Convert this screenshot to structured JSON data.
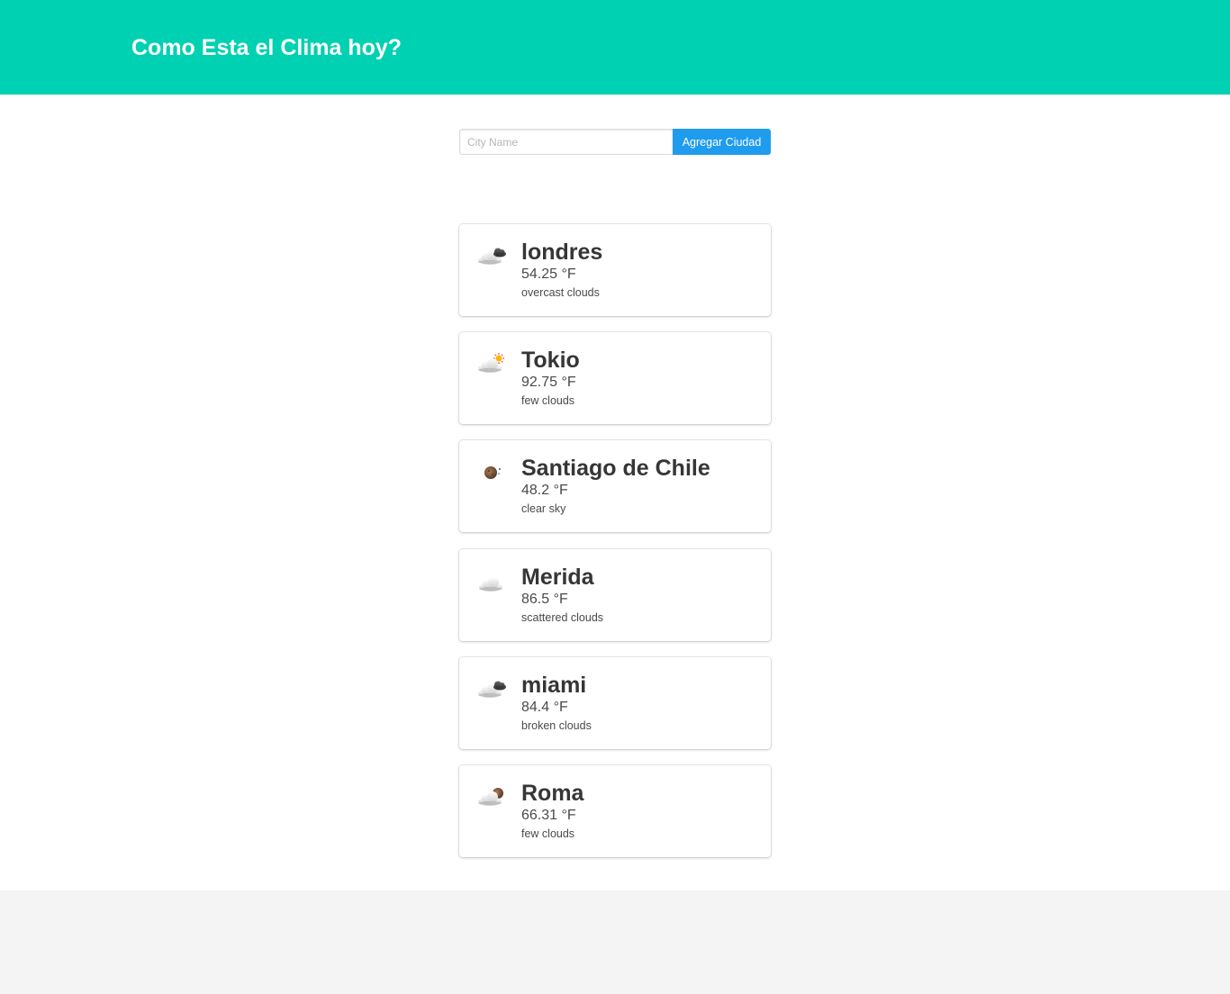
{
  "header": {
    "title": "Como Esta el Clima hoy?",
    "background_color": "#00d1b2"
  },
  "form": {
    "city_input": {
      "placeholder": "City Name",
      "value": ""
    },
    "add_button_label": "Agregar Ciudad",
    "button_color": "#209cee"
  },
  "cities": [
    {
      "name": "londres",
      "temp": "54.25 °F",
      "description": "overcast clouds",
      "icon": "overcast-clouds-icon"
    },
    {
      "name": "Tokio",
      "temp": "92.75 °F",
      "description": "few clouds",
      "icon": "few-clouds-day-icon"
    },
    {
      "name": "Santiago de Chile",
      "temp": "48.2 °F",
      "description": "clear sky",
      "icon": "clear-sky-night-icon"
    },
    {
      "name": "Merida",
      "temp": "86.5 °F",
      "description": "scattered clouds",
      "icon": "scattered-clouds-icon"
    },
    {
      "name": "miami",
      "temp": "84.4 °F",
      "description": "broken clouds",
      "icon": "broken-clouds-icon"
    },
    {
      "name": "Roma",
      "temp": "66.31 °F",
      "description": "few clouds",
      "icon": "few-clouds-night-icon"
    }
  ]
}
